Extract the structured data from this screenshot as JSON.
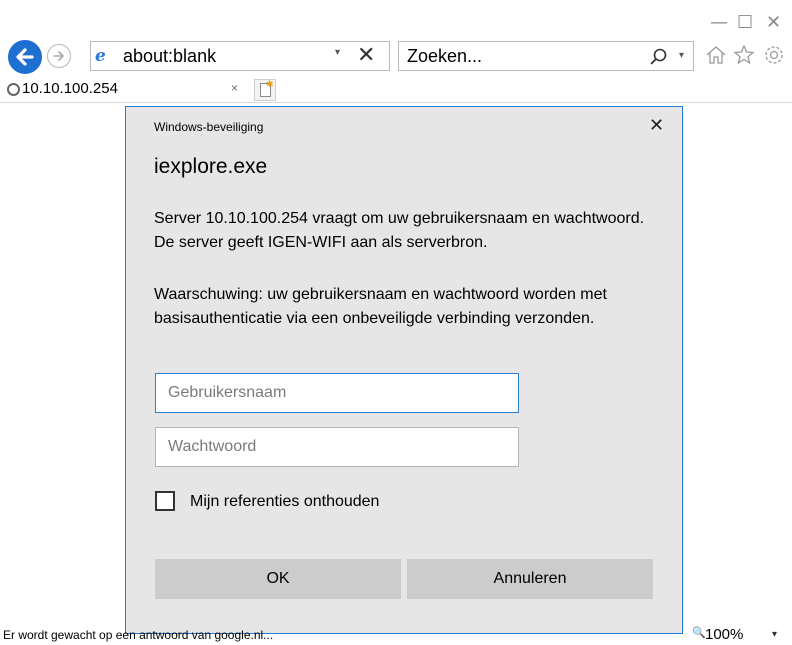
{
  "window_controls": {
    "minimize": "—",
    "maximize": "☐",
    "close": "✕"
  },
  "nav": {
    "address_url": "about:blank",
    "address_dropdown": "▾",
    "address_stop": "✕",
    "search_placeholder": "Zoeken...",
    "search_icon": "⚲",
    "search_dropdown": "▾",
    "home_icon": "⌂",
    "favorites_icon": "☆",
    "settings_icon": "⚙"
  },
  "tab": {
    "label": "10.10.100.254",
    "close": "×"
  },
  "dialog": {
    "title": "Windows-beveiliging",
    "close": "✕",
    "app": "iexplore.exe",
    "message": "Server 10.10.100.254 vraagt om uw gebruikersnaam en wachtwoord. De server geeft IGEN-WIFI aan als serverbron.",
    "warning": "Waarschuwing: uw gebruikersnaam en wachtwoord worden met basisauthenticatie via een onbeveiligde verbinding verzonden.",
    "username_placeholder": "Gebruikersnaam",
    "password_placeholder": "Wachtwoord",
    "remember_label": "Mijn referenties onthouden",
    "ok_label": "OK",
    "cancel_label": "Annuleren"
  },
  "status": {
    "text": "Er wordt gewacht op een antwoord van google.nl...",
    "zoom": "100%",
    "zoom_dropdown": "▾"
  },
  "colors": {
    "accent": "#1e6fd2",
    "dialog_bg": "#e6e6e6",
    "button_bg": "#cccccc"
  }
}
